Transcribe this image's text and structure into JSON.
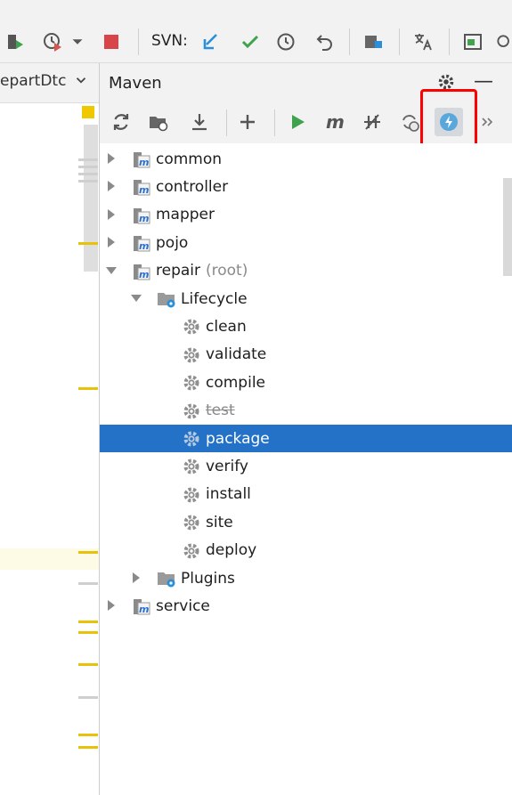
{
  "toolbar": {
    "svn_label": "SVN:"
  },
  "editor": {
    "tab_label": "epartDtc"
  },
  "maven": {
    "title": "Maven",
    "tree": [
      {
        "label": "common",
        "suffix": "",
        "kind": "module",
        "level": 0,
        "expanded": false,
        "selected": false,
        "disabled": false
      },
      {
        "label": "controller",
        "suffix": "",
        "kind": "module",
        "level": 0,
        "expanded": false,
        "selected": false,
        "disabled": false
      },
      {
        "label": "mapper",
        "suffix": "",
        "kind": "module",
        "level": 0,
        "expanded": false,
        "selected": false,
        "disabled": false
      },
      {
        "label": "pojo",
        "suffix": "",
        "kind": "module",
        "level": 0,
        "expanded": false,
        "selected": false,
        "disabled": false
      },
      {
        "label": "repair",
        "suffix": "(root)",
        "kind": "module",
        "level": 0,
        "expanded": true,
        "selected": false,
        "disabled": false
      },
      {
        "label": "Lifecycle",
        "suffix": "",
        "kind": "folder",
        "level": 1,
        "expanded": true,
        "selected": false,
        "disabled": false
      },
      {
        "label": "clean",
        "suffix": "",
        "kind": "goal",
        "level": 2,
        "expanded": false,
        "selected": false,
        "disabled": false
      },
      {
        "label": "validate",
        "suffix": "",
        "kind": "goal",
        "level": 2,
        "expanded": false,
        "selected": false,
        "disabled": false
      },
      {
        "label": "compile",
        "suffix": "",
        "kind": "goal",
        "level": 2,
        "expanded": false,
        "selected": false,
        "disabled": false
      },
      {
        "label": "test",
        "suffix": "",
        "kind": "goal",
        "level": 2,
        "expanded": false,
        "selected": false,
        "disabled": true
      },
      {
        "label": "package",
        "suffix": "",
        "kind": "goal",
        "level": 2,
        "expanded": false,
        "selected": true,
        "disabled": false
      },
      {
        "label": "verify",
        "suffix": "",
        "kind": "goal",
        "level": 2,
        "expanded": false,
        "selected": false,
        "disabled": false
      },
      {
        "label": "install",
        "suffix": "",
        "kind": "goal",
        "level": 2,
        "expanded": false,
        "selected": false,
        "disabled": false
      },
      {
        "label": "site",
        "suffix": "",
        "kind": "goal",
        "level": 2,
        "expanded": false,
        "selected": false,
        "disabled": false
      },
      {
        "label": "deploy",
        "suffix": "",
        "kind": "goal",
        "level": 2,
        "expanded": false,
        "selected": false,
        "disabled": false
      },
      {
        "label": "Plugins",
        "suffix": "",
        "kind": "folder",
        "level": 1,
        "expanded": false,
        "selected": false,
        "disabled": false
      },
      {
        "label": "service",
        "suffix": "",
        "kind": "module",
        "level": 0,
        "expanded": false,
        "selected": false,
        "disabled": false
      }
    ]
  }
}
